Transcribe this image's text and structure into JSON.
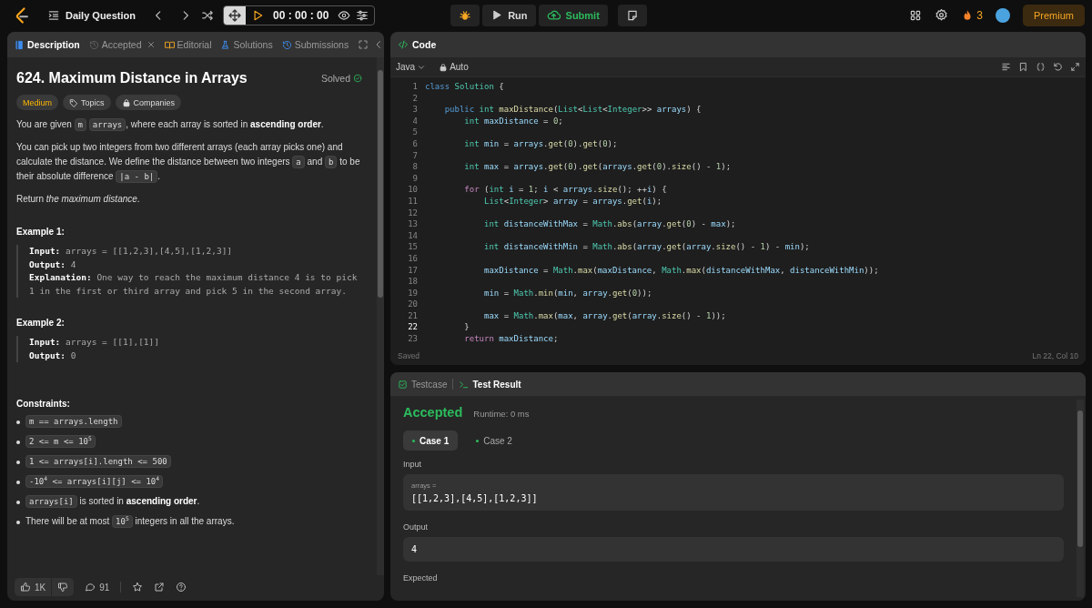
{
  "topbar": {
    "title": "Daily Question",
    "timer": "00 : 00 : 00",
    "run": "Run",
    "submit": "Submit",
    "streak": "3",
    "premium": "Premium"
  },
  "problem_tabs": [
    {
      "label": "Description",
      "kind": "description",
      "selected": true,
      "closable": false
    },
    {
      "label": "Accepted",
      "kind": "accepted",
      "selected": false,
      "closable": true
    },
    {
      "label": "Editorial",
      "kind": "editorial",
      "selected": false,
      "closable": false
    },
    {
      "label": "Solutions",
      "kind": "solutions",
      "selected": false,
      "closable": false
    },
    {
      "label": "Submissions",
      "kind": "submissions",
      "selected": false,
      "closable": false
    }
  ],
  "problem": {
    "title": "624. Maximum Distance in Arrays",
    "status": "Solved",
    "solved": true,
    "tags": [
      {
        "label": "Medium",
        "kind": "difficulty"
      },
      {
        "label": "Topics",
        "kind": "topics"
      },
      {
        "label": "Companies",
        "kind": "companies"
      }
    ],
    "paragraphs": [
      [
        {
          "kind": "text",
          "text": "You are given "
        },
        {
          "kind": "code",
          "text": "m"
        },
        {
          "kind": "code",
          "text": "arrays"
        },
        {
          "kind": "text",
          "text": ", where each array is sorted in **ascending order**."
        }
      ],
      [
        {
          "kind": "text",
          "text": "You can pick up two integers from two different arrays (each array picks one) and calculate the distance. We define the distance between two integers "
        },
        {
          "kind": "code",
          "text": "a"
        },
        {
          "kind": "text",
          "text": " and "
        },
        {
          "kind": "code",
          "text": "b"
        },
        {
          "kind": "text",
          "text": " to be their absolute difference "
        },
        {
          "kind": "code",
          "text": "|a - b|"
        },
        {
          "kind": "text",
          "text": "."
        }
      ],
      [
        {
          "kind": "text",
          "text": "Return *the maximum distance*."
        }
      ]
    ],
    "examples": [
      {
        "heading": "Example 1:",
        "lines": [
          {
            "label": "Input:",
            "value": "arrays = [[1,2,3],[4,5],[1,2,3]]"
          },
          {
            "label": "Output:",
            "value": "4"
          },
          {
            "label": "Explanation:",
            "value": "One way to reach the maximum distance 4 is to pick 1 in the first or third array and pick 5 in the second array."
          }
        ]
      },
      {
        "heading": "Example 2:",
        "lines": [
          {
            "label": "Input:",
            "value": "arrays = [[1],[1]]"
          },
          {
            "label": "Output:",
            "value": "0"
          }
        ]
      }
    ],
    "constraints_heading": "Constraints:",
    "constraints": [
      [
        {
          "kind": "code",
          "text": "m == arrays.length"
        }
      ],
      [
        {
          "kind": "code",
          "text": "2 <= m <= 10$^{5}$"
        }
      ],
      [
        {
          "kind": "code",
          "text": "1 <= arrays[i].length <= 500"
        }
      ],
      [
        {
          "kind": "code",
          "text": "-10$^{4}$ <= arrays[i][j] <= 10$^{4}$"
        }
      ],
      [
        {
          "kind": "code",
          "text": "arrays[i]"
        },
        {
          "kind": "text",
          "text": " is sorted in **ascending order**."
        }
      ],
      [
        {
          "kind": "text",
          "text": "There will be at most "
        },
        {
          "kind": "code",
          "text": "10$^{5}$"
        },
        {
          "kind": "text",
          "text": " integers in all the arrays."
        }
      ]
    ]
  },
  "problem_footer": {
    "likes": "1K",
    "comments": "91"
  },
  "editor": {
    "title": "Code",
    "language": "Java",
    "mode": "Auto",
    "status": "Saved",
    "cursor": "Ln 22, Col 10",
    "lines": [
      {
        "n": "1",
        "active": false,
        "tokens": [
          {
            "kind": "k",
            "text": "class"
          },
          {
            "kind": "t",
            "text": " Solution"
          },
          {
            "kind": "p",
            "text": " {"
          }
        ]
      },
      {
        "n": "2",
        "active": false
      },
      {
        "n": "3",
        "active": false,
        "tokens": [
          {
            "kind": "k",
            "text": "    public"
          },
          {
            "kind": "t",
            "text": " int"
          },
          {
            "kind": "f",
            "text": " maxDistance"
          },
          {
            "kind": "p",
            "text": "("
          },
          {
            "kind": "t",
            "text": "List"
          },
          {
            "kind": "p",
            "text": "<"
          },
          {
            "kind": "t",
            "text": "List"
          },
          {
            "kind": "p",
            "text": "<"
          },
          {
            "kind": "t",
            "text": "Integer"
          },
          {
            "kind": "p",
            "text": ">>"
          },
          {
            "kind": "v",
            "text": " arrays"
          },
          {
            "kind": "p",
            "text": ") {"
          }
        ]
      },
      {
        "n": "4",
        "active": false,
        "tokens": [
          {
            "kind": "t",
            "text": "        int"
          },
          {
            "kind": "v",
            "text": " maxDistance"
          },
          {
            "kind": "p",
            "text": " = "
          },
          {
            "kind": "n",
            "text": "0"
          },
          {
            "kind": "p",
            "text": ";"
          }
        ]
      },
      {
        "n": "5",
        "active": false
      },
      {
        "n": "6",
        "active": false,
        "tokens": [
          {
            "kind": "t",
            "text": "        int"
          },
          {
            "kind": "v",
            "text": " min"
          },
          {
            "kind": "p",
            "text": " = "
          },
          {
            "kind": "v",
            "text": "arrays"
          },
          {
            "kind": "p",
            "text": "."
          },
          {
            "kind": "f",
            "text": "get"
          },
          {
            "kind": "p",
            "text": "("
          },
          {
            "kind": "n",
            "text": "0"
          },
          {
            "kind": "p",
            "text": ")."
          },
          {
            "kind": "f",
            "text": "get"
          },
          {
            "kind": "p",
            "text": "("
          },
          {
            "kind": "n",
            "text": "0"
          },
          {
            "kind": "p",
            "text": ");"
          }
        ]
      },
      {
        "n": "7",
        "active": false
      },
      {
        "n": "8",
        "active": false,
        "tokens": [
          {
            "kind": "t",
            "text": "        int"
          },
          {
            "kind": "v",
            "text": " max"
          },
          {
            "kind": "p",
            "text": " = "
          },
          {
            "kind": "v",
            "text": "arrays"
          },
          {
            "kind": "p",
            "text": "."
          },
          {
            "kind": "f",
            "text": "get"
          },
          {
            "kind": "p",
            "text": "("
          },
          {
            "kind": "n",
            "text": "0"
          },
          {
            "kind": "p",
            "text": ")."
          },
          {
            "kind": "f",
            "text": "get"
          },
          {
            "kind": "p",
            "text": "("
          },
          {
            "kind": "v",
            "text": "arrays"
          },
          {
            "kind": "p",
            "text": "."
          },
          {
            "kind": "f",
            "text": "get"
          },
          {
            "kind": "p",
            "text": "("
          },
          {
            "kind": "n",
            "text": "0"
          },
          {
            "kind": "p",
            "text": ")."
          },
          {
            "kind": "f",
            "text": "size"
          },
          {
            "kind": "p",
            "text": "() - "
          },
          {
            "kind": "n",
            "text": "1"
          },
          {
            "kind": "p",
            "text": ");"
          }
        ]
      },
      {
        "n": "9",
        "active": false
      },
      {
        "n": "10",
        "active": false,
        "tokens": [
          {
            "kind": "c",
            "text": "        for"
          },
          {
            "kind": "p",
            "text": " ("
          },
          {
            "kind": "t",
            "text": "int"
          },
          {
            "kind": "v",
            "text": " i"
          },
          {
            "kind": "p",
            "text": " = "
          },
          {
            "kind": "n",
            "text": "1"
          },
          {
            "kind": "p",
            "text": "; "
          },
          {
            "kind": "v",
            "text": "i"
          },
          {
            "kind": "p",
            "text": " < "
          },
          {
            "kind": "v",
            "text": "arrays"
          },
          {
            "kind": "p",
            "text": "."
          },
          {
            "kind": "f",
            "text": "size"
          },
          {
            "kind": "p",
            "text": "(); ++"
          },
          {
            "kind": "v",
            "text": "i"
          },
          {
            "kind": "p",
            "text": ") {"
          }
        ]
      },
      {
        "n": "11",
        "active": false,
        "tokens": [
          {
            "kind": "t",
            "text": "            List"
          },
          {
            "kind": "p",
            "text": "<"
          },
          {
            "kind": "t",
            "text": "Integer"
          },
          {
            "kind": "p",
            "text": ">"
          },
          {
            "kind": "v",
            "text": " array"
          },
          {
            "kind": "p",
            "text": " = "
          },
          {
            "kind": "v",
            "text": "arrays"
          },
          {
            "kind": "p",
            "text": "."
          },
          {
            "kind": "f",
            "text": "get"
          },
          {
            "kind": "p",
            "text": "("
          },
          {
            "kind": "v",
            "text": "i"
          },
          {
            "kind": "p",
            "text": ");"
          }
        ]
      },
      {
        "n": "12",
        "active": false
      },
      {
        "n": "13",
        "active": false,
        "tokens": [
          {
            "kind": "t",
            "text": "            int"
          },
          {
            "kind": "v",
            "text": " distanceWithMax"
          },
          {
            "kind": "p",
            "text": " = "
          },
          {
            "kind": "t",
            "text": "Math"
          },
          {
            "kind": "p",
            "text": "."
          },
          {
            "kind": "f",
            "text": "abs"
          },
          {
            "kind": "p",
            "text": "("
          },
          {
            "kind": "v",
            "text": "array"
          },
          {
            "kind": "p",
            "text": "."
          },
          {
            "kind": "f",
            "text": "get"
          },
          {
            "kind": "p",
            "text": "("
          },
          {
            "kind": "n",
            "text": "0"
          },
          {
            "kind": "p",
            "text": ") - "
          },
          {
            "kind": "v",
            "text": "max"
          },
          {
            "kind": "p",
            "text": ");"
          }
        ]
      },
      {
        "n": "14",
        "active": false
      },
      {
        "n": "15",
        "active": false,
        "tokens": [
          {
            "kind": "t",
            "text": "            int"
          },
          {
            "kind": "v",
            "text": " distanceWithMin"
          },
          {
            "kind": "p",
            "text": " = "
          },
          {
            "kind": "t",
            "text": "Math"
          },
          {
            "kind": "p",
            "text": "."
          },
          {
            "kind": "f",
            "text": "abs"
          },
          {
            "kind": "p",
            "text": "("
          },
          {
            "kind": "v",
            "text": "array"
          },
          {
            "kind": "p",
            "text": "."
          },
          {
            "kind": "f",
            "text": "get"
          },
          {
            "kind": "p",
            "text": "("
          },
          {
            "kind": "v",
            "text": "array"
          },
          {
            "kind": "p",
            "text": "."
          },
          {
            "kind": "f",
            "text": "size"
          },
          {
            "kind": "p",
            "text": "() - "
          },
          {
            "kind": "n",
            "text": "1"
          },
          {
            "kind": "p",
            "text": ") - "
          },
          {
            "kind": "v",
            "text": "min"
          },
          {
            "kind": "p",
            "text": ");"
          }
        ]
      },
      {
        "n": "16",
        "active": false
      },
      {
        "n": "17",
        "active": false,
        "tokens": [
          {
            "kind": "v",
            "text": "            maxDistance"
          },
          {
            "kind": "p",
            "text": " = "
          },
          {
            "kind": "t",
            "text": "Math"
          },
          {
            "kind": "p",
            "text": "."
          },
          {
            "kind": "f",
            "text": "max"
          },
          {
            "kind": "p",
            "text": "("
          },
          {
            "kind": "v",
            "text": "maxDistance"
          },
          {
            "kind": "p",
            "text": ", "
          },
          {
            "kind": "t",
            "text": "Math"
          },
          {
            "kind": "p",
            "text": "."
          },
          {
            "kind": "f",
            "text": "max"
          },
          {
            "kind": "p",
            "text": "("
          },
          {
            "kind": "v",
            "text": "distanceWithMax"
          },
          {
            "kind": "p",
            "text": ", "
          },
          {
            "kind": "v",
            "text": "distanceWithMin"
          },
          {
            "kind": "p",
            "text": "));"
          }
        ]
      },
      {
        "n": "18",
        "active": false
      },
      {
        "n": "19",
        "active": false,
        "tokens": [
          {
            "kind": "v",
            "text": "            min"
          },
          {
            "kind": "p",
            "text": " = "
          },
          {
            "kind": "t",
            "text": "Math"
          },
          {
            "kind": "p",
            "text": "."
          },
          {
            "kind": "f",
            "text": "min"
          },
          {
            "kind": "p",
            "text": "("
          },
          {
            "kind": "v",
            "text": "min"
          },
          {
            "kind": "p",
            "text": ", "
          },
          {
            "kind": "v",
            "text": "array"
          },
          {
            "kind": "p",
            "text": "."
          },
          {
            "kind": "f",
            "text": "get"
          },
          {
            "kind": "p",
            "text": "("
          },
          {
            "kind": "n",
            "text": "0"
          },
          {
            "kind": "p",
            "text": "));"
          }
        ]
      },
      {
        "n": "20",
        "active": false
      },
      {
        "n": "21",
        "active": false,
        "tokens": [
          {
            "kind": "v",
            "text": "            max"
          },
          {
            "kind": "p",
            "text": " = "
          },
          {
            "kind": "t",
            "text": "Math"
          },
          {
            "kind": "p",
            "text": "."
          },
          {
            "kind": "f",
            "text": "max"
          },
          {
            "kind": "p",
            "text": "("
          },
          {
            "kind": "v",
            "text": "max"
          },
          {
            "kind": "p",
            "text": ", "
          },
          {
            "kind": "v",
            "text": "array"
          },
          {
            "kind": "p",
            "text": "."
          },
          {
            "kind": "f",
            "text": "get"
          },
          {
            "kind": "p",
            "text": "("
          },
          {
            "kind": "v",
            "text": "array"
          },
          {
            "kind": "p",
            "text": "."
          },
          {
            "kind": "f",
            "text": "size"
          },
          {
            "kind": "p",
            "text": "() - "
          },
          {
            "kind": "n",
            "text": "1"
          },
          {
            "kind": "p",
            "text": "));"
          }
        ]
      },
      {
        "n": "22",
        "active": true,
        "tokens": [
          {
            "kind": "p",
            "text": "        }"
          }
        ]
      },
      {
        "n": "23",
        "active": false,
        "tokens": [
          {
            "kind": "c",
            "text": "        return"
          },
          {
            "kind": "v",
            "text": " maxDistance"
          },
          {
            "kind": "p",
            "text": ";"
          }
        ]
      }
    ]
  },
  "result_tabs": [
    {
      "label": "Testcase",
      "kind": "testcase",
      "selected": false
    },
    {
      "label": "Test Result",
      "kind": "result",
      "selected": true
    }
  ],
  "result": {
    "verdict": "Accepted",
    "runtime": "Runtime: 0 ms",
    "cases": [
      {
        "label": "Case 1",
        "selected": true,
        "passed": true
      },
      {
        "label": "Case 2",
        "selected": false,
        "passed": true
      }
    ],
    "input_heading": "Input",
    "inputs": [
      {
        "name": "arrays =",
        "value": "[[1,2,3],[4,5],[1,2,3]]"
      }
    ],
    "output_heading": "Output",
    "output": "4",
    "expected_heading": "Expected"
  }
}
